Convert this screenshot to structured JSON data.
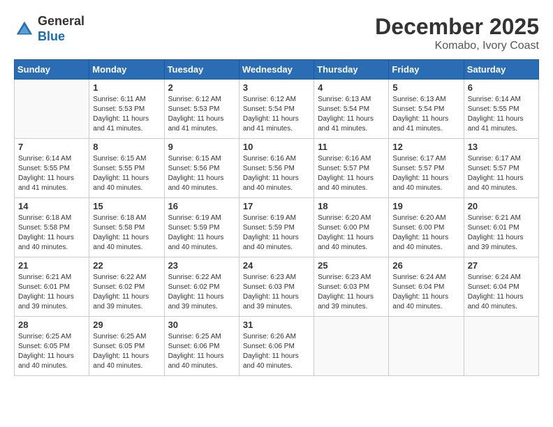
{
  "header": {
    "logo_line1": "General",
    "logo_line2": "Blue",
    "month": "December 2025",
    "location": "Komabo, Ivory Coast"
  },
  "weekdays": [
    "Sunday",
    "Monday",
    "Tuesday",
    "Wednesday",
    "Thursday",
    "Friday",
    "Saturday"
  ],
  "weeks": [
    [
      {
        "day": "",
        "sunrise": "",
        "sunset": "",
        "daylight": ""
      },
      {
        "day": "1",
        "sunrise": "Sunrise: 6:11 AM",
        "sunset": "Sunset: 5:53 PM",
        "daylight": "Daylight: 11 hours and 41 minutes."
      },
      {
        "day": "2",
        "sunrise": "Sunrise: 6:12 AM",
        "sunset": "Sunset: 5:53 PM",
        "daylight": "Daylight: 11 hours and 41 minutes."
      },
      {
        "day": "3",
        "sunrise": "Sunrise: 6:12 AM",
        "sunset": "Sunset: 5:54 PM",
        "daylight": "Daylight: 11 hours and 41 minutes."
      },
      {
        "day": "4",
        "sunrise": "Sunrise: 6:13 AM",
        "sunset": "Sunset: 5:54 PM",
        "daylight": "Daylight: 11 hours and 41 minutes."
      },
      {
        "day": "5",
        "sunrise": "Sunrise: 6:13 AM",
        "sunset": "Sunset: 5:54 PM",
        "daylight": "Daylight: 11 hours and 41 minutes."
      },
      {
        "day": "6",
        "sunrise": "Sunrise: 6:14 AM",
        "sunset": "Sunset: 5:55 PM",
        "daylight": "Daylight: 11 hours and 41 minutes."
      }
    ],
    [
      {
        "day": "7",
        "sunrise": "Sunrise: 6:14 AM",
        "sunset": "Sunset: 5:55 PM",
        "daylight": "Daylight: 11 hours and 41 minutes."
      },
      {
        "day": "8",
        "sunrise": "Sunrise: 6:15 AM",
        "sunset": "Sunset: 5:55 PM",
        "daylight": "Daylight: 11 hours and 40 minutes."
      },
      {
        "day": "9",
        "sunrise": "Sunrise: 6:15 AM",
        "sunset": "Sunset: 5:56 PM",
        "daylight": "Daylight: 11 hours and 40 minutes."
      },
      {
        "day": "10",
        "sunrise": "Sunrise: 6:16 AM",
        "sunset": "Sunset: 5:56 PM",
        "daylight": "Daylight: 11 hours and 40 minutes."
      },
      {
        "day": "11",
        "sunrise": "Sunrise: 6:16 AM",
        "sunset": "Sunset: 5:57 PM",
        "daylight": "Daylight: 11 hours and 40 minutes."
      },
      {
        "day": "12",
        "sunrise": "Sunrise: 6:17 AM",
        "sunset": "Sunset: 5:57 PM",
        "daylight": "Daylight: 11 hours and 40 minutes."
      },
      {
        "day": "13",
        "sunrise": "Sunrise: 6:17 AM",
        "sunset": "Sunset: 5:57 PM",
        "daylight": "Daylight: 11 hours and 40 minutes."
      }
    ],
    [
      {
        "day": "14",
        "sunrise": "Sunrise: 6:18 AM",
        "sunset": "Sunset: 5:58 PM",
        "daylight": "Daylight: 11 hours and 40 minutes."
      },
      {
        "day": "15",
        "sunrise": "Sunrise: 6:18 AM",
        "sunset": "Sunset: 5:58 PM",
        "daylight": "Daylight: 11 hours and 40 minutes."
      },
      {
        "day": "16",
        "sunrise": "Sunrise: 6:19 AM",
        "sunset": "Sunset: 5:59 PM",
        "daylight": "Daylight: 11 hours and 40 minutes."
      },
      {
        "day": "17",
        "sunrise": "Sunrise: 6:19 AM",
        "sunset": "Sunset: 5:59 PM",
        "daylight": "Daylight: 11 hours and 40 minutes."
      },
      {
        "day": "18",
        "sunrise": "Sunrise: 6:20 AM",
        "sunset": "Sunset: 6:00 PM",
        "daylight": "Daylight: 11 hours and 40 minutes."
      },
      {
        "day": "19",
        "sunrise": "Sunrise: 6:20 AM",
        "sunset": "Sunset: 6:00 PM",
        "daylight": "Daylight: 11 hours and 40 minutes."
      },
      {
        "day": "20",
        "sunrise": "Sunrise: 6:21 AM",
        "sunset": "Sunset: 6:01 PM",
        "daylight": "Daylight: 11 hours and 39 minutes."
      }
    ],
    [
      {
        "day": "21",
        "sunrise": "Sunrise: 6:21 AM",
        "sunset": "Sunset: 6:01 PM",
        "daylight": "Daylight: 11 hours and 39 minutes."
      },
      {
        "day": "22",
        "sunrise": "Sunrise: 6:22 AM",
        "sunset": "Sunset: 6:02 PM",
        "daylight": "Daylight: 11 hours and 39 minutes."
      },
      {
        "day": "23",
        "sunrise": "Sunrise: 6:22 AM",
        "sunset": "Sunset: 6:02 PM",
        "daylight": "Daylight: 11 hours and 39 minutes."
      },
      {
        "day": "24",
        "sunrise": "Sunrise: 6:23 AM",
        "sunset": "Sunset: 6:03 PM",
        "daylight": "Daylight: 11 hours and 39 minutes."
      },
      {
        "day": "25",
        "sunrise": "Sunrise: 6:23 AM",
        "sunset": "Sunset: 6:03 PM",
        "daylight": "Daylight: 11 hours and 39 minutes."
      },
      {
        "day": "26",
        "sunrise": "Sunrise: 6:24 AM",
        "sunset": "Sunset: 6:04 PM",
        "daylight": "Daylight: 11 hours and 40 minutes."
      },
      {
        "day": "27",
        "sunrise": "Sunrise: 6:24 AM",
        "sunset": "Sunset: 6:04 PM",
        "daylight": "Daylight: 11 hours and 40 minutes."
      }
    ],
    [
      {
        "day": "28",
        "sunrise": "Sunrise: 6:25 AM",
        "sunset": "Sunset: 6:05 PM",
        "daylight": "Daylight: 11 hours and 40 minutes."
      },
      {
        "day": "29",
        "sunrise": "Sunrise: 6:25 AM",
        "sunset": "Sunset: 6:05 PM",
        "daylight": "Daylight: 11 hours and 40 minutes."
      },
      {
        "day": "30",
        "sunrise": "Sunrise: 6:25 AM",
        "sunset": "Sunset: 6:06 PM",
        "daylight": "Daylight: 11 hours and 40 minutes."
      },
      {
        "day": "31",
        "sunrise": "Sunrise: 6:26 AM",
        "sunset": "Sunset: 6:06 PM",
        "daylight": "Daylight: 11 hours and 40 minutes."
      },
      {
        "day": "",
        "sunrise": "",
        "sunset": "",
        "daylight": ""
      },
      {
        "day": "",
        "sunrise": "",
        "sunset": "",
        "daylight": ""
      },
      {
        "day": "",
        "sunrise": "",
        "sunset": "",
        "daylight": ""
      }
    ]
  ]
}
